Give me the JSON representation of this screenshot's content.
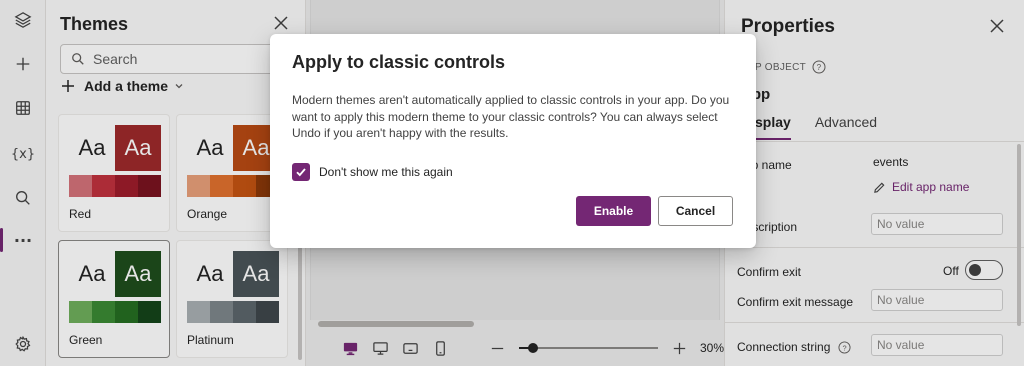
{
  "rail": {
    "items": [
      "layers-icon",
      "insert-icon",
      "data-icon",
      "variables-icon",
      "search-icon",
      "more-icon",
      "settings-icon"
    ],
    "variables_text": "{x}",
    "more_text": "···"
  },
  "themes": {
    "title": "Themes",
    "search_placeholder": "Search",
    "add_theme_label": "Add a theme",
    "cards": [
      {
        "name": "Red",
        "aa": "Aa",
        "primary": "#9e2a2b",
        "swatches": [
          "#d4727a",
          "#c0313e",
          "#9e1c2b",
          "#7a1420"
        ]
      },
      {
        "name": "Orange",
        "aa": "Aa",
        "primary": "#b84a14",
        "swatches": [
          "#e8a07a",
          "#e0712e",
          "#c45412",
          "#8f3a0a"
        ]
      },
      {
        "name": "Green",
        "aa": "Aa",
        "primary": "#1f4d1c",
        "swatches": [
          "#6fae5c",
          "#3a8a34",
          "#256e22",
          "#15441a"
        ],
        "selected": true
      },
      {
        "name": "Platinum",
        "aa": "Aa",
        "primary": "#4a5459",
        "swatches": [
          "#a9afb3",
          "#7d868b",
          "#5c666b",
          "#3f474b"
        ]
      }
    ]
  },
  "canvas": {
    "zoom_text": "30%",
    "zoom_level": 0.1
  },
  "properties": {
    "title": "Properties",
    "object_type": "APP OBJECT",
    "object_name": "App",
    "tabs": [
      "Display",
      "Advanced"
    ],
    "rows": {
      "app_name_label": "App name",
      "app_name_value": "events",
      "edit_app_name": "Edit app name",
      "description_label": "Description",
      "description_placeholder": "No value",
      "confirm_exit_label": "Confirm exit",
      "confirm_exit_value": "Off",
      "confirm_exit_message_label": "Confirm exit message",
      "confirm_exit_message_placeholder": "No value",
      "connection_string_label": "Connection string",
      "connection_string_placeholder": "No value"
    }
  },
  "dialog": {
    "title": "Apply to classic controls",
    "body": "Modern themes aren't automatically applied to classic controls in your app. Do you want to apply this modern theme to your classic controls? You can always select Undo if you aren't happy with the results.",
    "checkbox_label": "Don't show me this again",
    "checkbox_checked": true,
    "enable_label": "Enable",
    "cancel_label": "Cancel",
    "accent": "#742774"
  }
}
